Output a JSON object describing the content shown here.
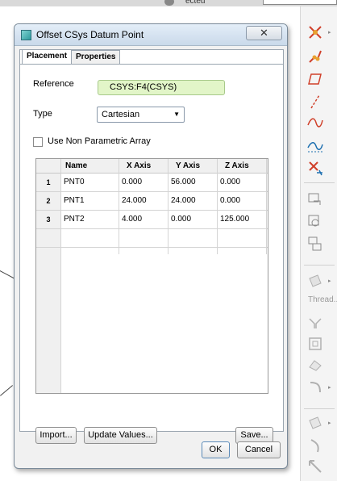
{
  "background": {
    "top_label": "ecteu"
  },
  "toolbar": {
    "thread_label": "Thread..."
  },
  "dialog": {
    "title": "Offset CSys Datum Point",
    "close_symbol": "✕",
    "tabs": [
      {
        "label": "Placement",
        "active": true
      },
      {
        "label": "Properties",
        "active": false
      }
    ],
    "reference_label": "Reference",
    "reference_value": "CSYS:F4(CSYS)",
    "type_label": "Type",
    "type_value": "Cartesian",
    "checkbox_label": "Use Non Parametric Array",
    "checkbox_checked": false,
    "table": {
      "headers": [
        "",
        "Name",
        "X Axis",
        "Y Axis",
        "Z Axis"
      ],
      "rows": [
        {
          "num": "1",
          "name": "PNT0",
          "x": "0.000",
          "y": "56.000",
          "z": "0.000"
        },
        {
          "num": "2",
          "name": "PNT1",
          "x": "24.000",
          "y": "24.000",
          "z": "0.000"
        },
        {
          "num": "3",
          "name": "PNT2",
          "x": "4.000",
          "y": "0.000",
          "z": "125.000"
        }
      ]
    },
    "buttons": {
      "import": "Import...",
      "update": "Update Values...",
      "save": "Save...",
      "ok": "OK",
      "cancel": "Cancel"
    }
  },
  "colors": {
    "reference_bg": "#e2f5c8",
    "title_gradient_top": "#e4eef8",
    "title_gradient_bottom": "#c9d9ea"
  }
}
